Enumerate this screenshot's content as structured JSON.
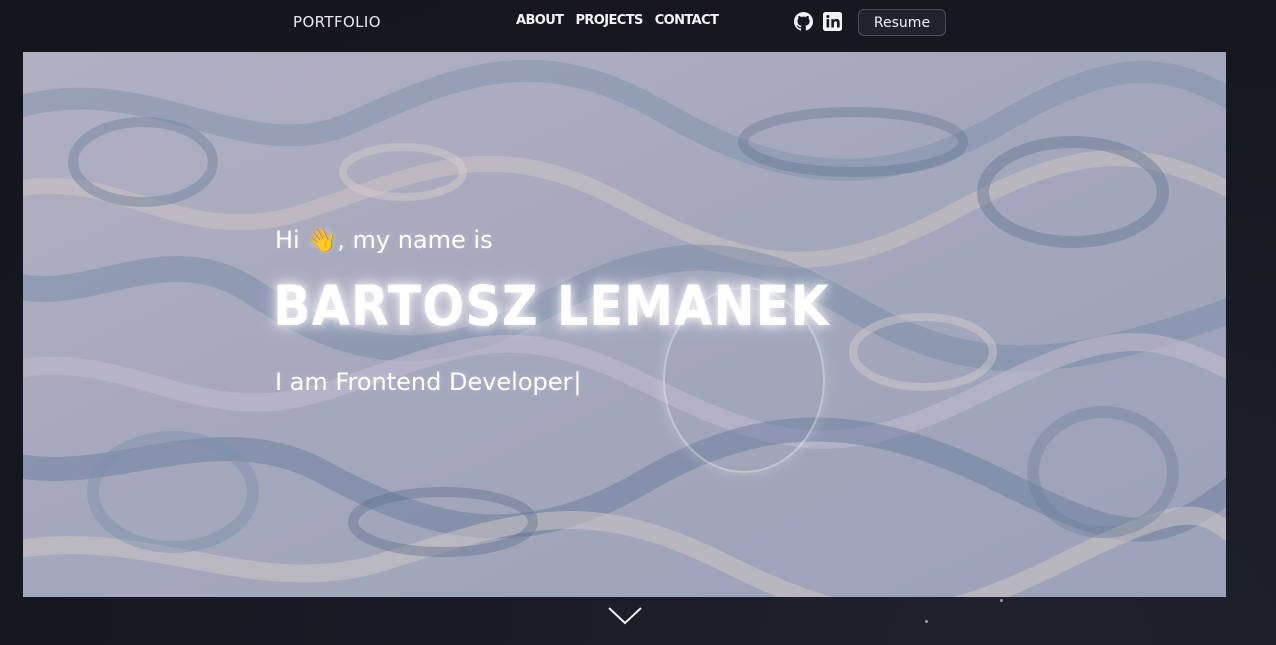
{
  "nav": {
    "brand": "PORTFOLIO",
    "links": [
      {
        "label": "ABOUT"
      },
      {
        "label": "PROJECTS"
      },
      {
        "label": "CONTACT"
      }
    ],
    "icons": [
      "github-icon",
      "linkedin-icon"
    ],
    "resume_label": "Resume"
  },
  "hero": {
    "greeting_prefix": "Hi ",
    "greeting_emoji": "👋",
    "greeting_suffix": ", my name is",
    "name": "BARTOSZ LEMANEK",
    "role_text": "I am Frontend Developer",
    "cursor": "|"
  },
  "colors": {
    "background": "#171a22",
    "text": "#ffffff",
    "hero_base": "#a9a9bb",
    "button_border": "#4a4f5c"
  }
}
